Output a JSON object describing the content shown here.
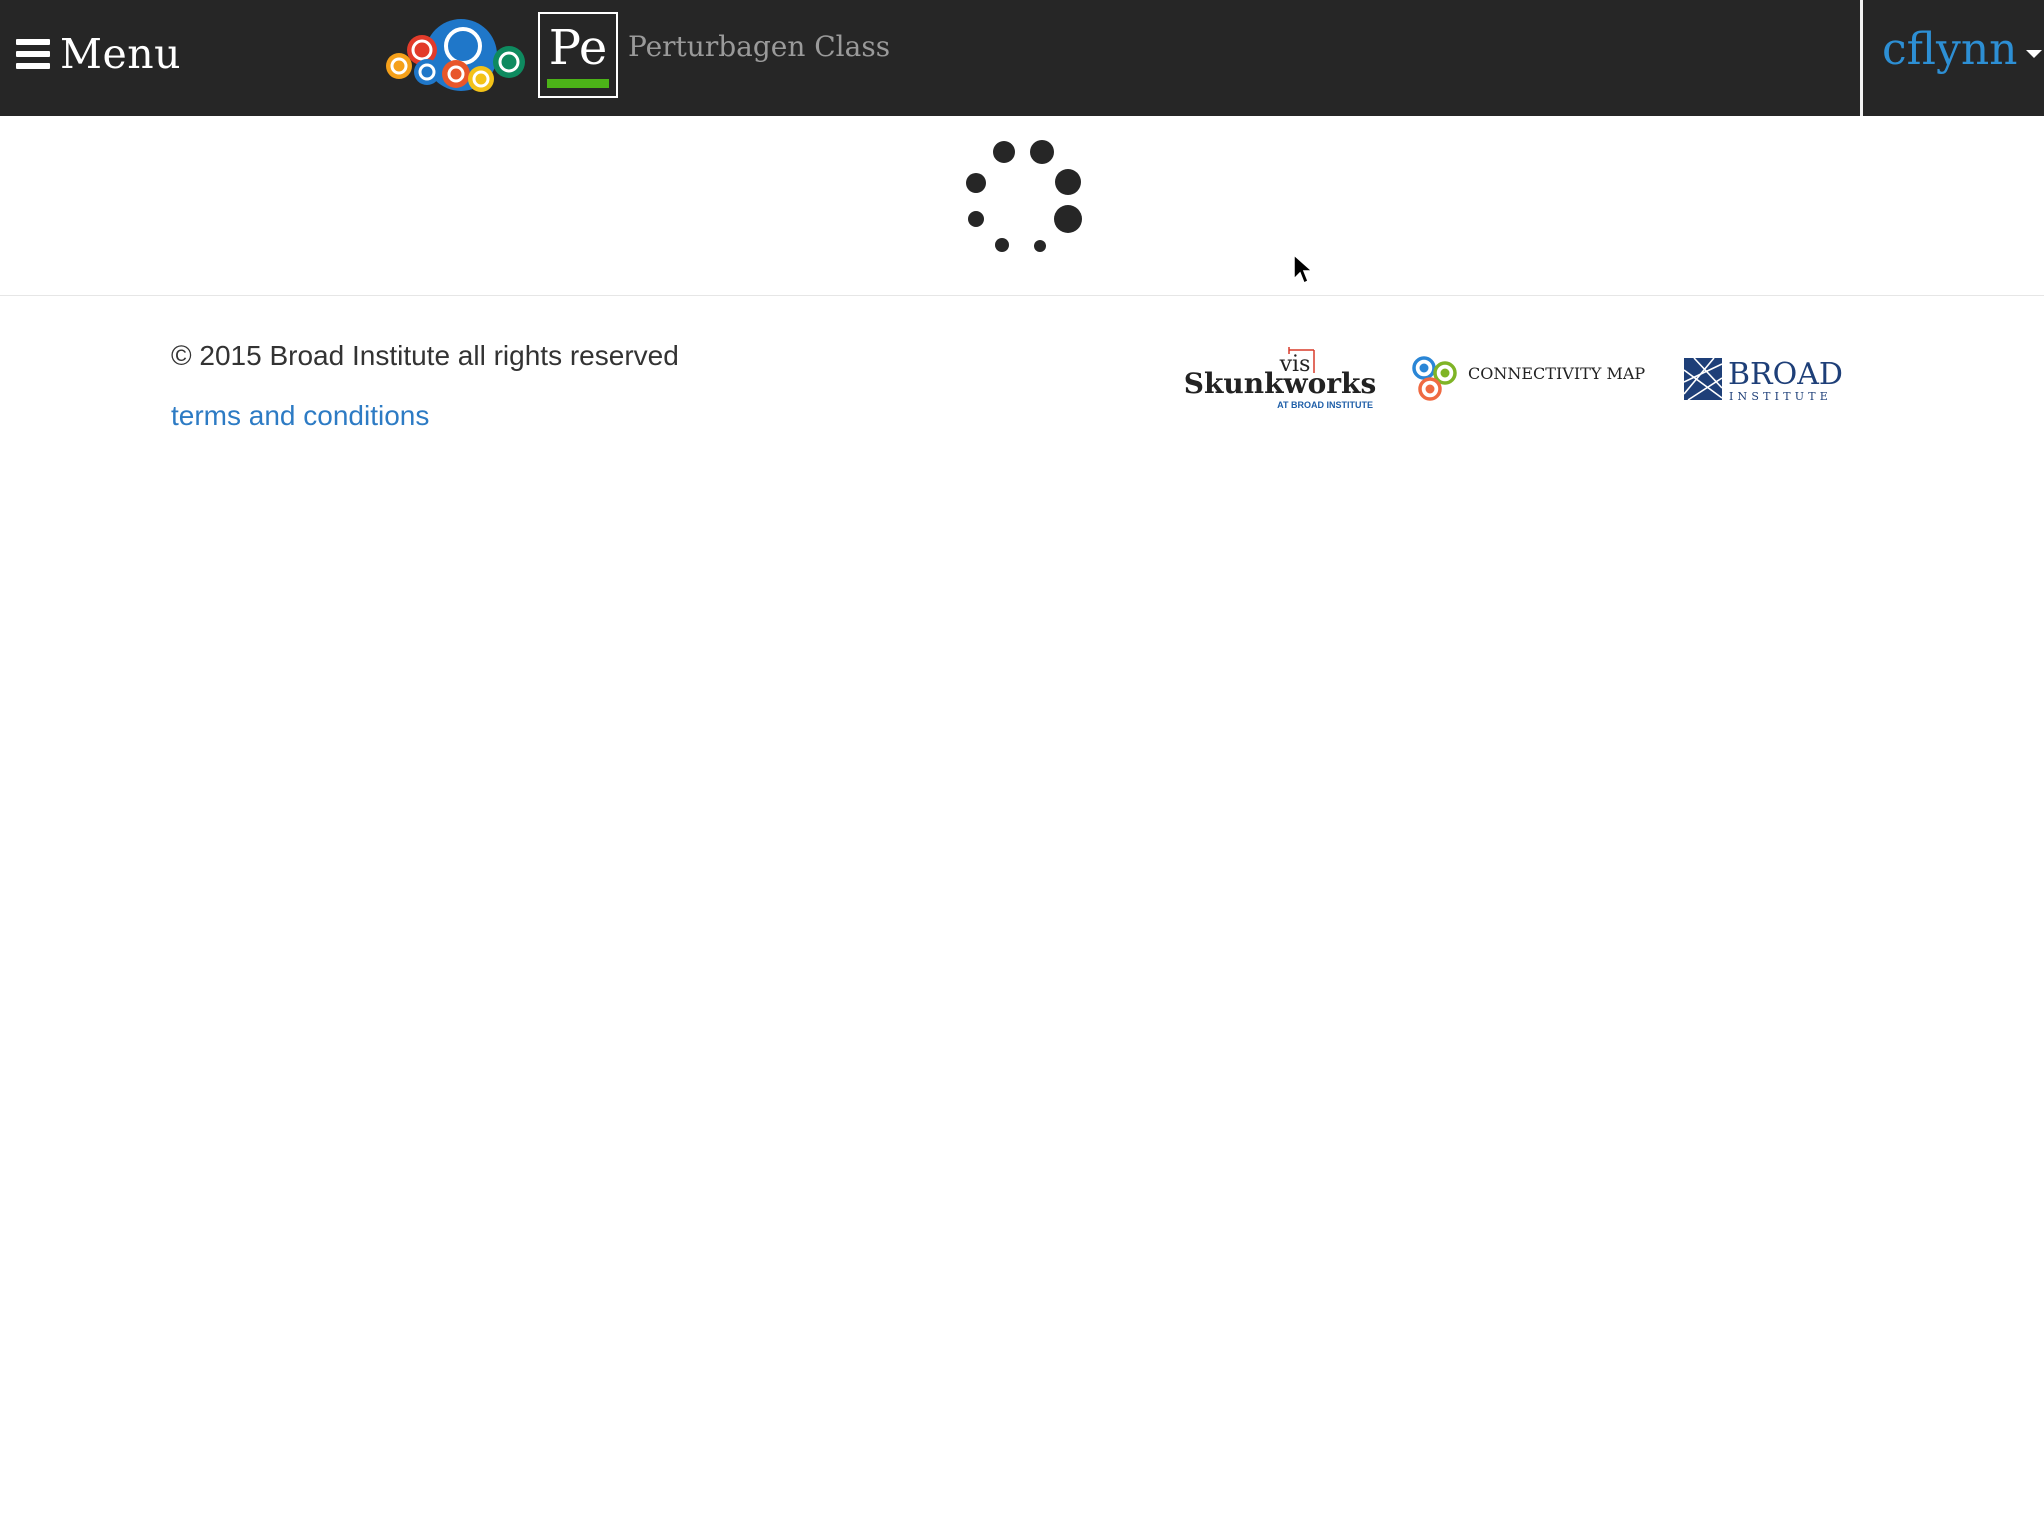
{
  "navbar": {
    "menu_label": "Menu",
    "menu_icon": "hamburger-icon",
    "app_badge": "Pe",
    "page_title": "Perturbagen Class",
    "user_name": "cflynn",
    "user_menu_icon": "caret-down-icon"
  },
  "content": {
    "loading_icon": "spinner-icon"
  },
  "footer": {
    "copyright": "© 2015 Broad Institute all rights reserved",
    "terms_link": "terms and conditions",
    "logos": {
      "skunkworks_top": "vis",
      "skunkworks_main": "Skunkworks",
      "skunkworks_sub": "AT BROAD INSTITUTE",
      "cmap": "CONNECTIVITY MAP",
      "broad_main": "BROAD",
      "broad_sub": "INSTITUTE"
    }
  },
  "colors": {
    "navbar_bg": "#262626",
    "user_link": "#2d8fd4",
    "terms_link": "#2d7bc4",
    "pe_accent": "#4cb318"
  }
}
